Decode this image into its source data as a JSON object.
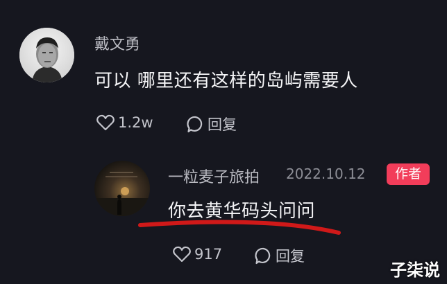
{
  "comment": {
    "author": "戴文勇",
    "text": "可以 哪里还有这样的岛屿需要人",
    "like_count": "1.2w",
    "reply_label": "回复"
  },
  "reply": {
    "author": "一粒麦子旅拍",
    "date": "2022.10.12",
    "badge": "作者",
    "text": "你去黄华码头问问",
    "like_count": "917",
    "reply_label": "回复"
  },
  "watermark": "子柒说",
  "colors": {
    "background": "#16171f",
    "badge": "#f23d5a",
    "annotation_underline": "#d01919"
  },
  "icons": [
    "heart-icon",
    "comment-bubble-icon"
  ]
}
